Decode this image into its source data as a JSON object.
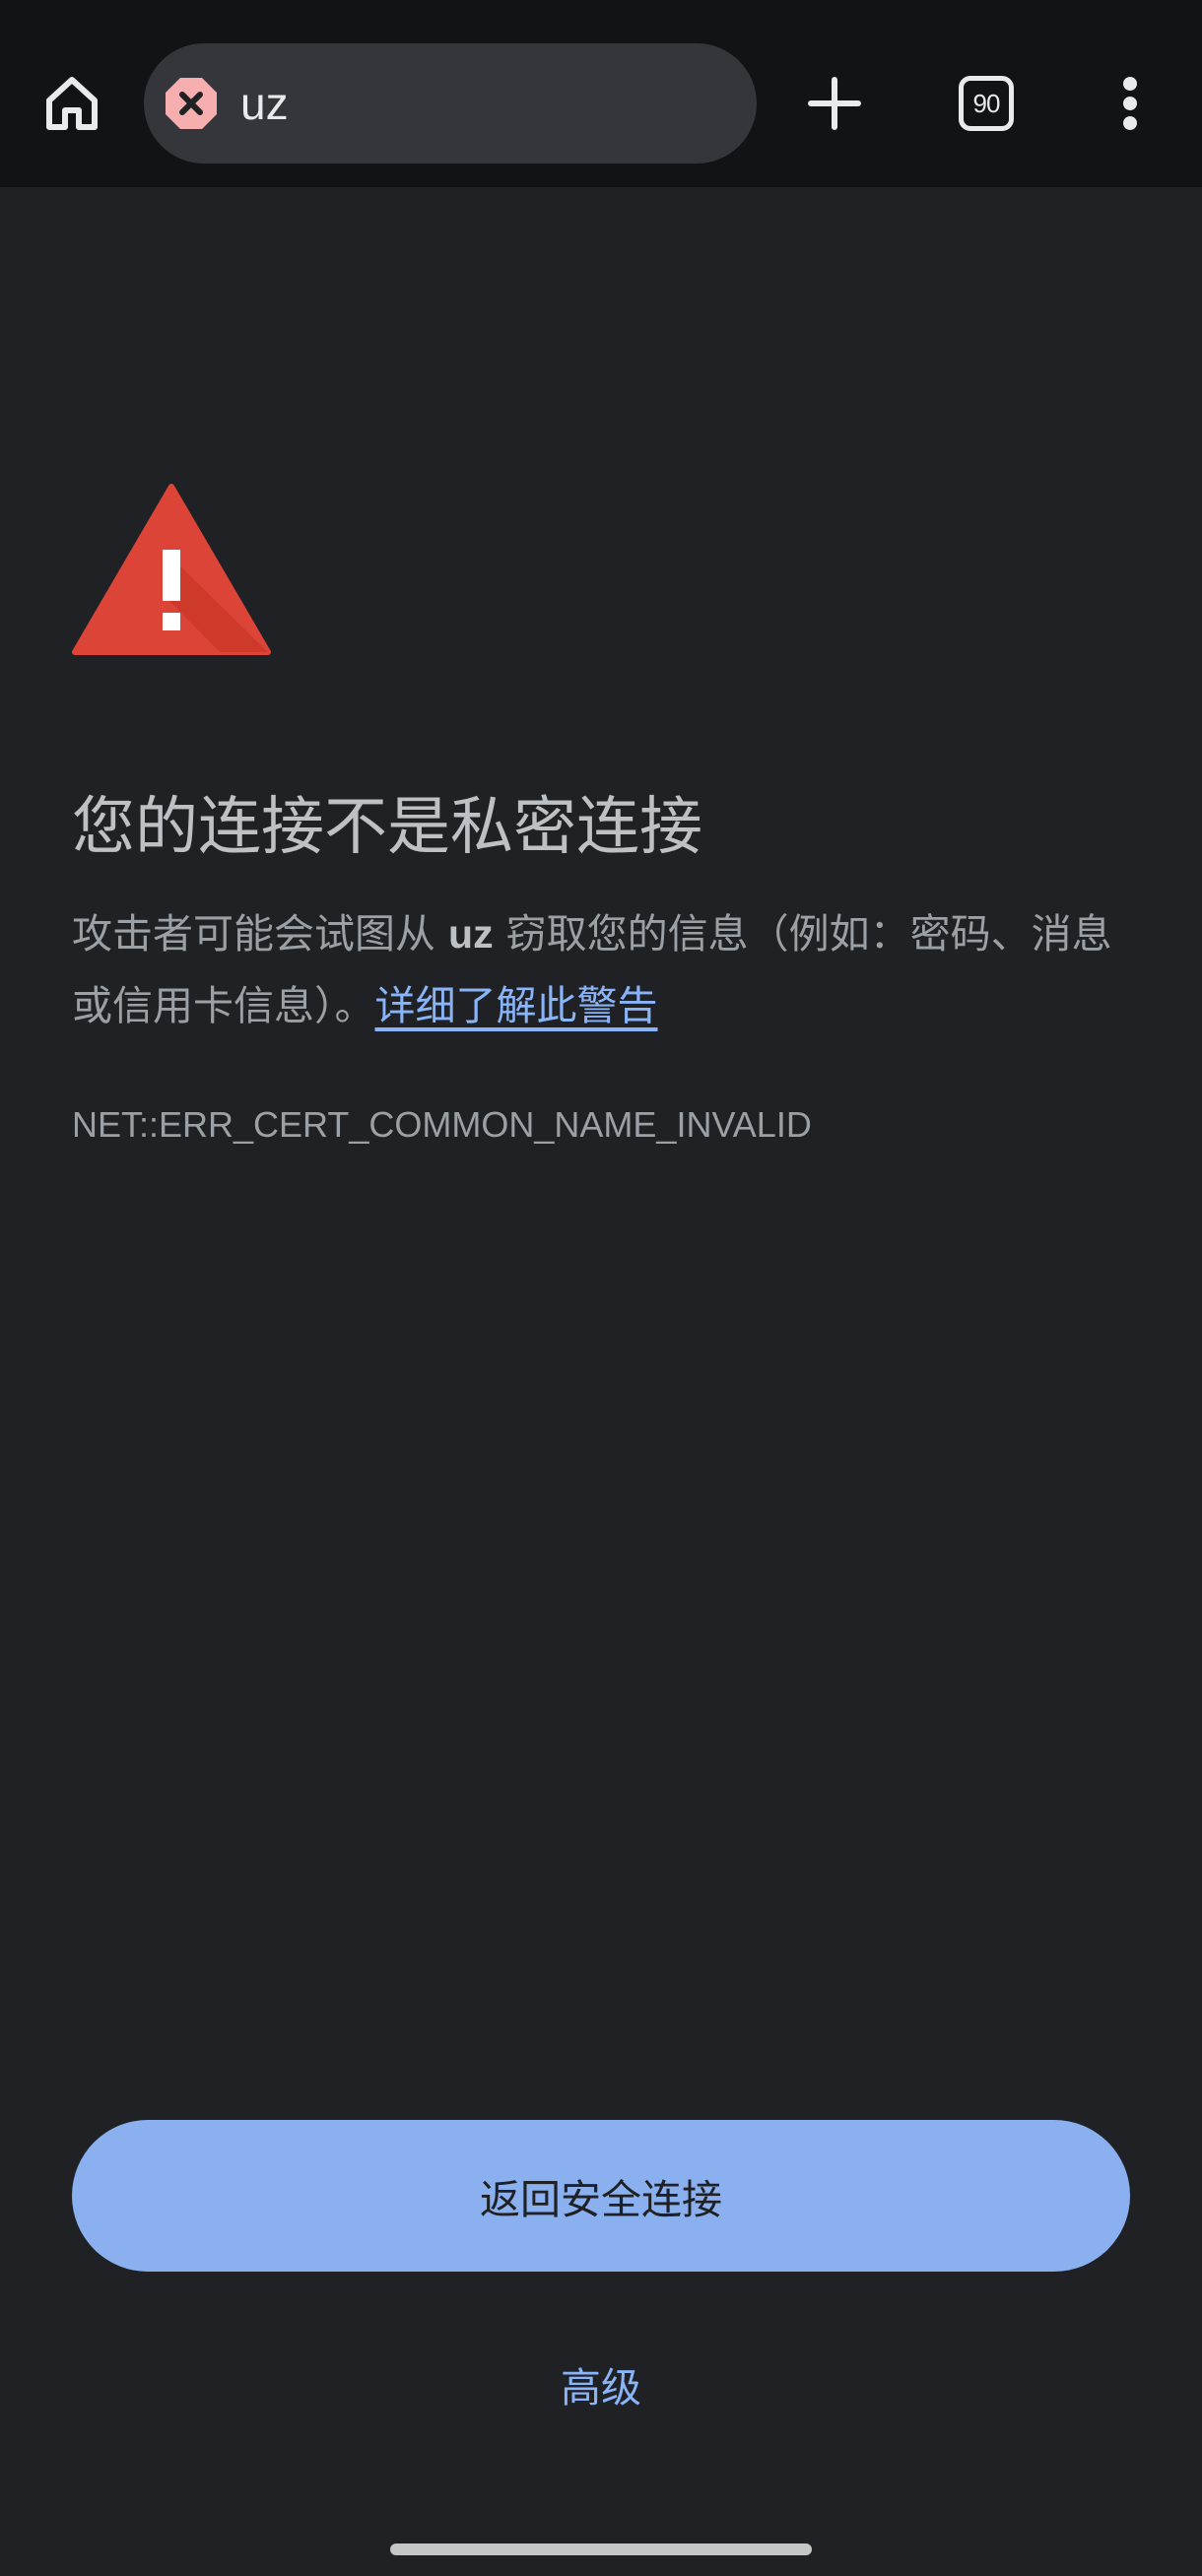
{
  "toolbar": {
    "url": "uz",
    "tab_count": "90",
    "icons": {
      "home": "home-icon",
      "security": "not-secure-icon",
      "new_tab": "plus-icon",
      "menu": "more-vert-icon"
    }
  },
  "interstitial": {
    "heading": "您的连接不是私密连接",
    "description_before": "攻击者可能会试图从",
    "host": "uz",
    "description_after": "窃取您的信息（例如：密码、消息或信用卡信息）。",
    "learn_more_link": "详细了解此警告",
    "error_code": "NET::ERR_CERT_COMMON_NAME_INVALID"
  },
  "actions": {
    "back_to_safety": "返回安全连接",
    "advanced": "高级"
  },
  "colors": {
    "warning_red": "#db4437",
    "primary_button": "#8ab0ef",
    "link": "#8ab4f8",
    "background": "#202124"
  }
}
